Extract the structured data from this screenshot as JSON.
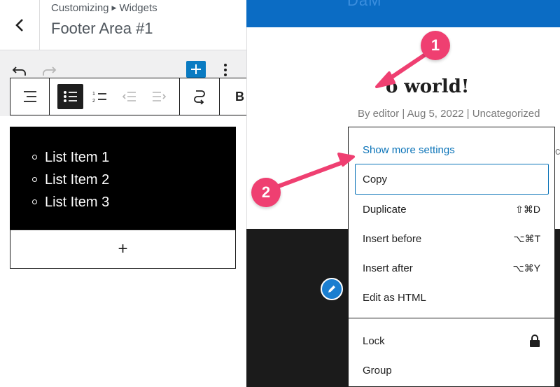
{
  "panel": {
    "breadcrumb_root": "Customizing",
    "breadcrumb_section": "Widgets",
    "title": "Footer Area #1"
  },
  "list": {
    "items": [
      "List Item 1",
      "List Item 2",
      "List Item 3"
    ],
    "appender_label": "+"
  },
  "preview": {
    "logo_text": "DaM",
    "post_title": "o world!",
    "post_meta": "By editor | Aug 5, 2022 | Uncategorized",
    "post_edge": "c"
  },
  "menu": {
    "show_more": "Show more settings",
    "items": [
      {
        "label": "Copy",
        "shortcut": ""
      },
      {
        "label": "Duplicate",
        "shortcut": "⇧⌘D"
      },
      {
        "label": "Insert before",
        "shortcut": "⌥⌘T"
      },
      {
        "label": "Insert after",
        "shortcut": "⌥⌘Y"
      },
      {
        "label": "Edit as HTML",
        "shortcut": ""
      },
      {
        "label": "Lock",
        "shortcut": ""
      },
      {
        "label": "Group",
        "shortcut": ""
      }
    ]
  },
  "callouts": {
    "one": "1",
    "two": "2"
  },
  "colors": {
    "accent": "#0a7bc2",
    "callout": "#ef3f71",
    "site_header": "#0b6cc4"
  },
  "icons": [
    "back-chevron-icon",
    "undo-icon",
    "redo-icon",
    "plus-icon",
    "more-vertical-icon",
    "list-view-icon",
    "unordered-list-icon",
    "ordered-list-icon",
    "outdent-icon",
    "indent-icon",
    "transform-icon",
    "bold-icon",
    "italic-icon",
    "link-icon",
    "chevron-down-icon",
    "pencil-icon",
    "lock-icon"
  ]
}
